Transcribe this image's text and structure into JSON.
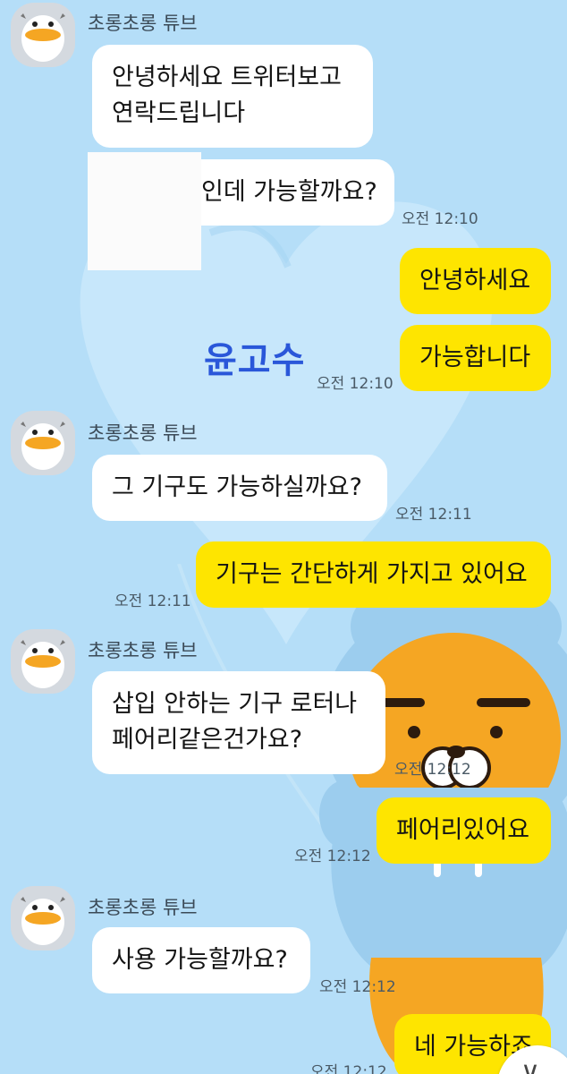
{
  "sender": {
    "name": "초롱초롱 튜브"
  },
  "watermark": "윤고수",
  "messages": [
    {
      "id": "m1",
      "side": "in",
      "lines": [
        "안녕하세요 트위터보고",
        "연락드립니다"
      ]
    },
    {
      "id": "m2",
      "side": "in",
      "lines": [
        "인데 가능할까요?"
      ],
      "time": "오전 12:10"
    },
    {
      "id": "m3",
      "side": "out",
      "lines": [
        "안녕하세요"
      ]
    },
    {
      "id": "m4",
      "side": "out",
      "lines": [
        "가능합니다"
      ],
      "time": "오전 12:10"
    },
    {
      "id": "m5",
      "side": "in",
      "lines": [
        "그 기구도 가능하실까요?"
      ],
      "time": "오전 12:11"
    },
    {
      "id": "m6",
      "side": "out",
      "lines": [
        "기구는 간단하게 가지고 있어요"
      ],
      "time": "오전 12:11"
    },
    {
      "id": "m7",
      "side": "in",
      "lines": [
        "삽입 안하는 기구 로터나",
        "페어리같은건가요?"
      ],
      "time": "오전 12:12"
    },
    {
      "id": "m8",
      "side": "out",
      "lines": [
        "페어리있어요"
      ],
      "time": "오전 12:12"
    },
    {
      "id": "m9",
      "side": "in",
      "lines": [
        "사용 가능할까요?"
      ],
      "time": "오전 12:12"
    },
    {
      "id": "m10",
      "side": "out",
      "lines": [
        "네 가능하죠"
      ],
      "time": "오전 12:12"
    }
  ],
  "icons": {
    "avatar": "tube-duck-avatar-icon",
    "scroll": "chevron-down-icon"
  },
  "colors": {
    "background": "#b5def8",
    "incoming": "#ffffff",
    "outgoing": "#fee500",
    "watermark": "#2a57d9"
  }
}
